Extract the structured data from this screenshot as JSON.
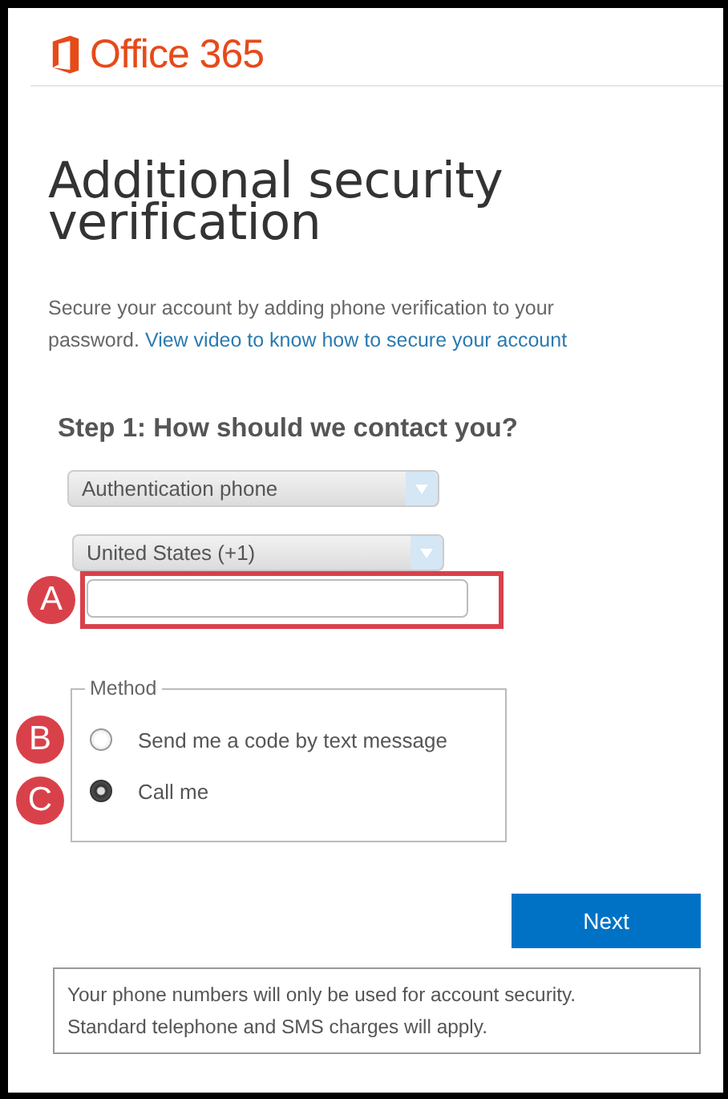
{
  "brand": {
    "name": "Office 365"
  },
  "title": "Additional security verification",
  "intro": {
    "text": "Secure your account by adding phone verification to your password.",
    "link": "View video to know how to secure your account"
  },
  "step": {
    "heading": "Step 1: How should we contact you?"
  },
  "selects": [
    {
      "value": "Authentication phone"
    },
    {
      "value": "United States (+1)"
    }
  ],
  "phone_field": {
    "highlighted": true,
    "badge": "A"
  },
  "method": {
    "legend": "Method",
    "options": [
      {
        "label": "Send me a code by text message",
        "selected": false,
        "badge": "B"
      },
      {
        "label": "Call me",
        "selected": true,
        "badge": "C"
      }
    ]
  },
  "next_button": "Next",
  "notice": "Your phone numbers will only be used for account security. Standard telephone and SMS charges will apply."
}
